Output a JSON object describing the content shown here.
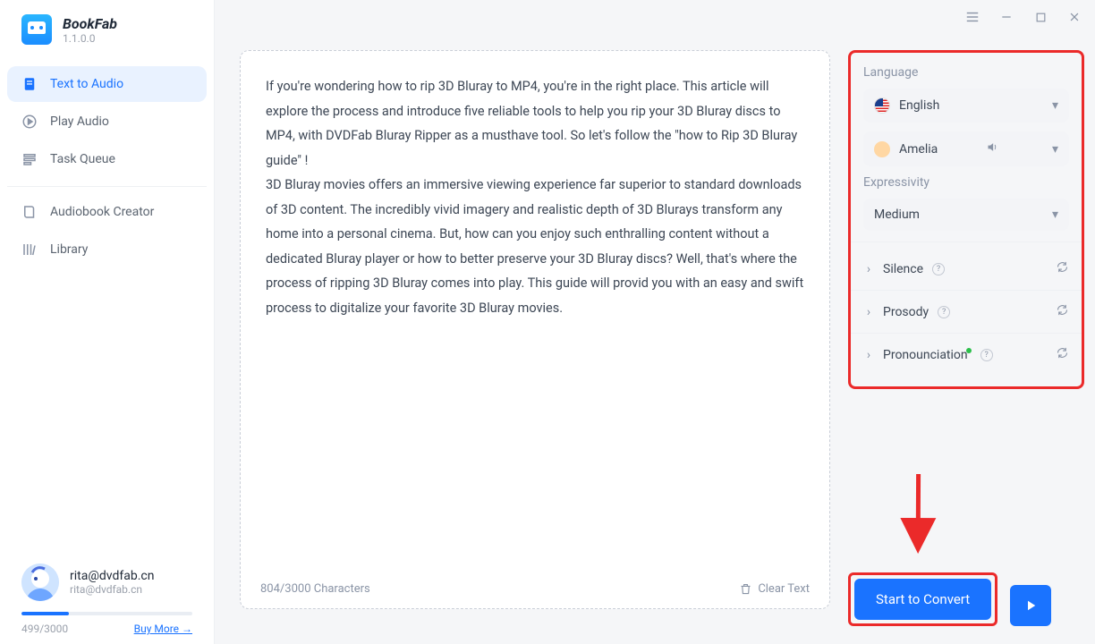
{
  "app": {
    "name": "BookFab",
    "version": "1.1.0.0"
  },
  "sidebar": {
    "items": [
      {
        "label": "Text to Audio"
      },
      {
        "label": "Play Audio"
      },
      {
        "label": "Task Queue"
      },
      {
        "label": "Audiobook Creator"
      },
      {
        "label": "Library"
      }
    ]
  },
  "account": {
    "email1": "rita@dvdfab.cn",
    "email2": "rita@dvdfab.cn",
    "quota": "499/3000",
    "buy": "Buy More →"
  },
  "text": {
    "p1": "If you're wondering how to rip 3D Bluray to MP4, you're in the right place. This article will explore the process and introduce five reliable tools to help you rip your 3D Bluray discs to MP4, with DVDFab Bluray Ripper as a musthave tool. So let's follow the \"how to Rip 3D Bluray guide\" !",
    "p2": "3D Bluray movies offers an immersive viewing experience far superior to standard downloads of 3D content. The incredibly vivid imagery and realistic depth of 3D Blurays transform any home into a personal cinema. But, how can you enjoy such enthralling content without a dedicated Bluray player or how to better preserve your 3D Bluray discs? Well, that's where the process of ripping 3D Bluray comes into play. This guide will provid you with an easy and swift process to digitalize your favorite 3D Bluray movies.",
    "counter": "804/3000 Characters",
    "clear": "Clear Text"
  },
  "settings": {
    "language_label": "Language",
    "language_value": "English",
    "voice_value": "Amelia",
    "expressivity_label": "Expressivity",
    "expressivity_value": "Medium",
    "silence": "Silence",
    "prosody": "Prosody",
    "pronunciation": "Pronounciation"
  },
  "cta": {
    "label": "Start to Convert"
  }
}
